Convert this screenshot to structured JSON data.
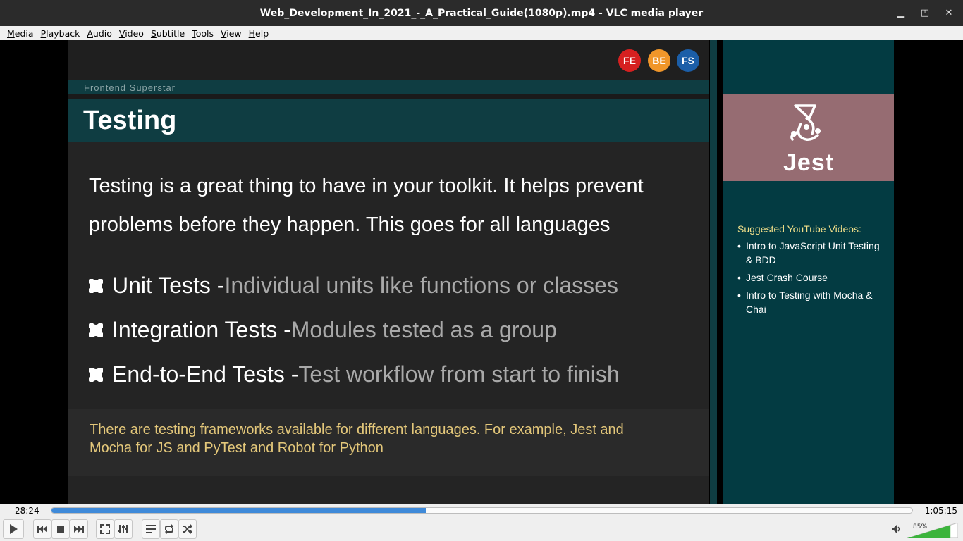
{
  "window": {
    "title": "Web_Development_In_2021_-_A_Practical_Guide(1080p).mp4 - VLC media player",
    "minimize_glyph": "▁",
    "restore_glyph": "◰",
    "close_glyph": "✕"
  },
  "menu": {
    "items": [
      {
        "label": "Media",
        "u": "M",
        "rest": "edia"
      },
      {
        "label": "Playback",
        "u": "P",
        "rest": "layback"
      },
      {
        "label": "Audio",
        "u": "A",
        "rest": "udio"
      },
      {
        "label": "Video",
        "u": "V",
        "rest": "ideo"
      },
      {
        "label": "Subtitle",
        "u": "S",
        "rest": "ubtitle"
      },
      {
        "label": "Tools",
        "u": "T",
        "rest": "ools"
      },
      {
        "label": "View",
        "u": "V",
        "rest": "iew"
      },
      {
        "label": "Help",
        "u": "H",
        "rest": "elp"
      }
    ]
  },
  "slide": {
    "badges": [
      "FE",
      "BE",
      "FS"
    ],
    "badge_colors": [
      "#d62020",
      "#f0962a",
      "#1b5ea8"
    ],
    "section_label": "Frontend Superstar",
    "title": "Testing",
    "intro": "Testing is a great thing to have in your toolkit. It helps prevent problems before they happen. This goes for all languages",
    "bullets": [
      {
        "head": "Unit Tests - ",
        "desc": "Individual units like functions or classes"
      },
      {
        "head": "Integration Tests - ",
        "desc": "Modules tested as a group"
      },
      {
        "head": "End-to-End Tests - ",
        "desc": "Test workflow from start to finish"
      }
    ],
    "note": "There are testing frameworks available for different languages. For example, Jest and Mocha for JS and PyTest and Robot for Python",
    "accent_color": "#0f3d42",
    "note_color": "#e3c77a"
  },
  "sidebar": {
    "logo_text": "Jest",
    "logo_icon": "jest-jester-icon",
    "suggested_title": "Suggested YouTube Videos:",
    "videos": [
      "Intro to JavaScript Unit Testing & BDD",
      "Jest Crash Course",
      "Intro to Testing with Mocha & Chai"
    ]
  },
  "player": {
    "elapsed": "28:24",
    "total": "1:05:15",
    "progress_fraction": 0.435,
    "volume_label": "85%",
    "volume_fraction": 0.85,
    "progress_color": "#3f8ad9",
    "volume_color": "#3cb43c",
    "buttons": [
      "play-icon",
      "previous-icon",
      "stop-icon",
      "next-icon",
      "fullscreen-icon",
      "extended-settings-icon",
      "playlist-icon",
      "loop-icon",
      "shuffle-icon"
    ]
  }
}
